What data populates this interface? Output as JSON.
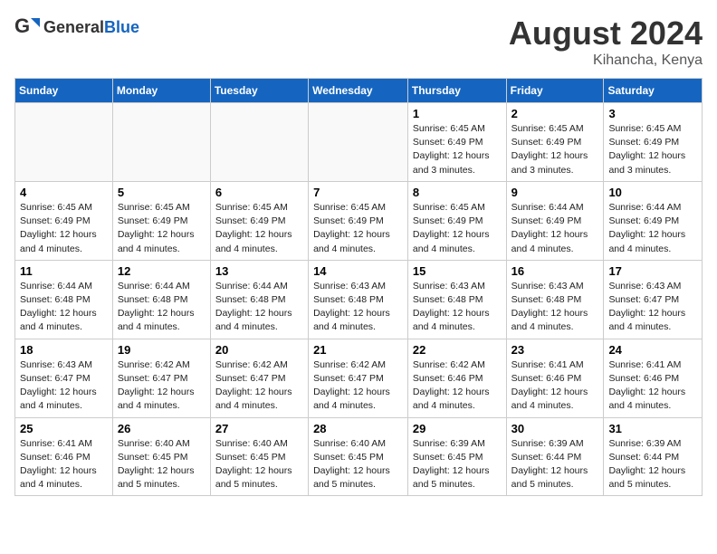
{
  "header": {
    "logo_general": "General",
    "logo_blue": "Blue",
    "month_year": "August 2024",
    "location": "Kihancha, Kenya"
  },
  "weekdays": [
    "Sunday",
    "Monday",
    "Tuesday",
    "Wednesday",
    "Thursday",
    "Friday",
    "Saturday"
  ],
  "weeks": [
    [
      {
        "day": "",
        "info": "",
        "empty": true
      },
      {
        "day": "",
        "info": "",
        "empty": true
      },
      {
        "day": "",
        "info": "",
        "empty": true
      },
      {
        "day": "",
        "info": "",
        "empty": true
      },
      {
        "day": "1",
        "info": "Sunrise: 6:45 AM\nSunset: 6:49 PM\nDaylight: 12 hours\nand 3 minutes."
      },
      {
        "day": "2",
        "info": "Sunrise: 6:45 AM\nSunset: 6:49 PM\nDaylight: 12 hours\nand 3 minutes."
      },
      {
        "day": "3",
        "info": "Sunrise: 6:45 AM\nSunset: 6:49 PM\nDaylight: 12 hours\nand 3 minutes."
      }
    ],
    [
      {
        "day": "4",
        "info": "Sunrise: 6:45 AM\nSunset: 6:49 PM\nDaylight: 12 hours\nand 4 minutes."
      },
      {
        "day": "5",
        "info": "Sunrise: 6:45 AM\nSunset: 6:49 PM\nDaylight: 12 hours\nand 4 minutes."
      },
      {
        "day": "6",
        "info": "Sunrise: 6:45 AM\nSunset: 6:49 PM\nDaylight: 12 hours\nand 4 minutes."
      },
      {
        "day": "7",
        "info": "Sunrise: 6:45 AM\nSunset: 6:49 PM\nDaylight: 12 hours\nand 4 minutes."
      },
      {
        "day": "8",
        "info": "Sunrise: 6:45 AM\nSunset: 6:49 PM\nDaylight: 12 hours\nand 4 minutes."
      },
      {
        "day": "9",
        "info": "Sunrise: 6:44 AM\nSunset: 6:49 PM\nDaylight: 12 hours\nand 4 minutes."
      },
      {
        "day": "10",
        "info": "Sunrise: 6:44 AM\nSunset: 6:49 PM\nDaylight: 12 hours\nand 4 minutes."
      }
    ],
    [
      {
        "day": "11",
        "info": "Sunrise: 6:44 AM\nSunset: 6:48 PM\nDaylight: 12 hours\nand 4 minutes."
      },
      {
        "day": "12",
        "info": "Sunrise: 6:44 AM\nSunset: 6:48 PM\nDaylight: 12 hours\nand 4 minutes."
      },
      {
        "day": "13",
        "info": "Sunrise: 6:44 AM\nSunset: 6:48 PM\nDaylight: 12 hours\nand 4 minutes."
      },
      {
        "day": "14",
        "info": "Sunrise: 6:43 AM\nSunset: 6:48 PM\nDaylight: 12 hours\nand 4 minutes."
      },
      {
        "day": "15",
        "info": "Sunrise: 6:43 AM\nSunset: 6:48 PM\nDaylight: 12 hours\nand 4 minutes."
      },
      {
        "day": "16",
        "info": "Sunrise: 6:43 AM\nSunset: 6:48 PM\nDaylight: 12 hours\nand 4 minutes."
      },
      {
        "day": "17",
        "info": "Sunrise: 6:43 AM\nSunset: 6:47 PM\nDaylight: 12 hours\nand 4 minutes."
      }
    ],
    [
      {
        "day": "18",
        "info": "Sunrise: 6:43 AM\nSunset: 6:47 PM\nDaylight: 12 hours\nand 4 minutes."
      },
      {
        "day": "19",
        "info": "Sunrise: 6:42 AM\nSunset: 6:47 PM\nDaylight: 12 hours\nand 4 minutes."
      },
      {
        "day": "20",
        "info": "Sunrise: 6:42 AM\nSunset: 6:47 PM\nDaylight: 12 hours\nand 4 minutes."
      },
      {
        "day": "21",
        "info": "Sunrise: 6:42 AM\nSunset: 6:47 PM\nDaylight: 12 hours\nand 4 minutes."
      },
      {
        "day": "22",
        "info": "Sunrise: 6:42 AM\nSunset: 6:46 PM\nDaylight: 12 hours\nand 4 minutes."
      },
      {
        "day": "23",
        "info": "Sunrise: 6:41 AM\nSunset: 6:46 PM\nDaylight: 12 hours\nand 4 minutes."
      },
      {
        "day": "24",
        "info": "Sunrise: 6:41 AM\nSunset: 6:46 PM\nDaylight: 12 hours\nand 4 minutes."
      }
    ],
    [
      {
        "day": "25",
        "info": "Sunrise: 6:41 AM\nSunset: 6:46 PM\nDaylight: 12 hours\nand 4 minutes."
      },
      {
        "day": "26",
        "info": "Sunrise: 6:40 AM\nSunset: 6:45 PM\nDaylight: 12 hours\nand 5 minutes."
      },
      {
        "day": "27",
        "info": "Sunrise: 6:40 AM\nSunset: 6:45 PM\nDaylight: 12 hours\nand 5 minutes."
      },
      {
        "day": "28",
        "info": "Sunrise: 6:40 AM\nSunset: 6:45 PM\nDaylight: 12 hours\nand 5 minutes."
      },
      {
        "day": "29",
        "info": "Sunrise: 6:39 AM\nSunset: 6:45 PM\nDaylight: 12 hours\nand 5 minutes."
      },
      {
        "day": "30",
        "info": "Sunrise: 6:39 AM\nSunset: 6:44 PM\nDaylight: 12 hours\nand 5 minutes."
      },
      {
        "day": "31",
        "info": "Sunrise: 6:39 AM\nSunset: 6:44 PM\nDaylight: 12 hours\nand 5 minutes."
      }
    ]
  ]
}
